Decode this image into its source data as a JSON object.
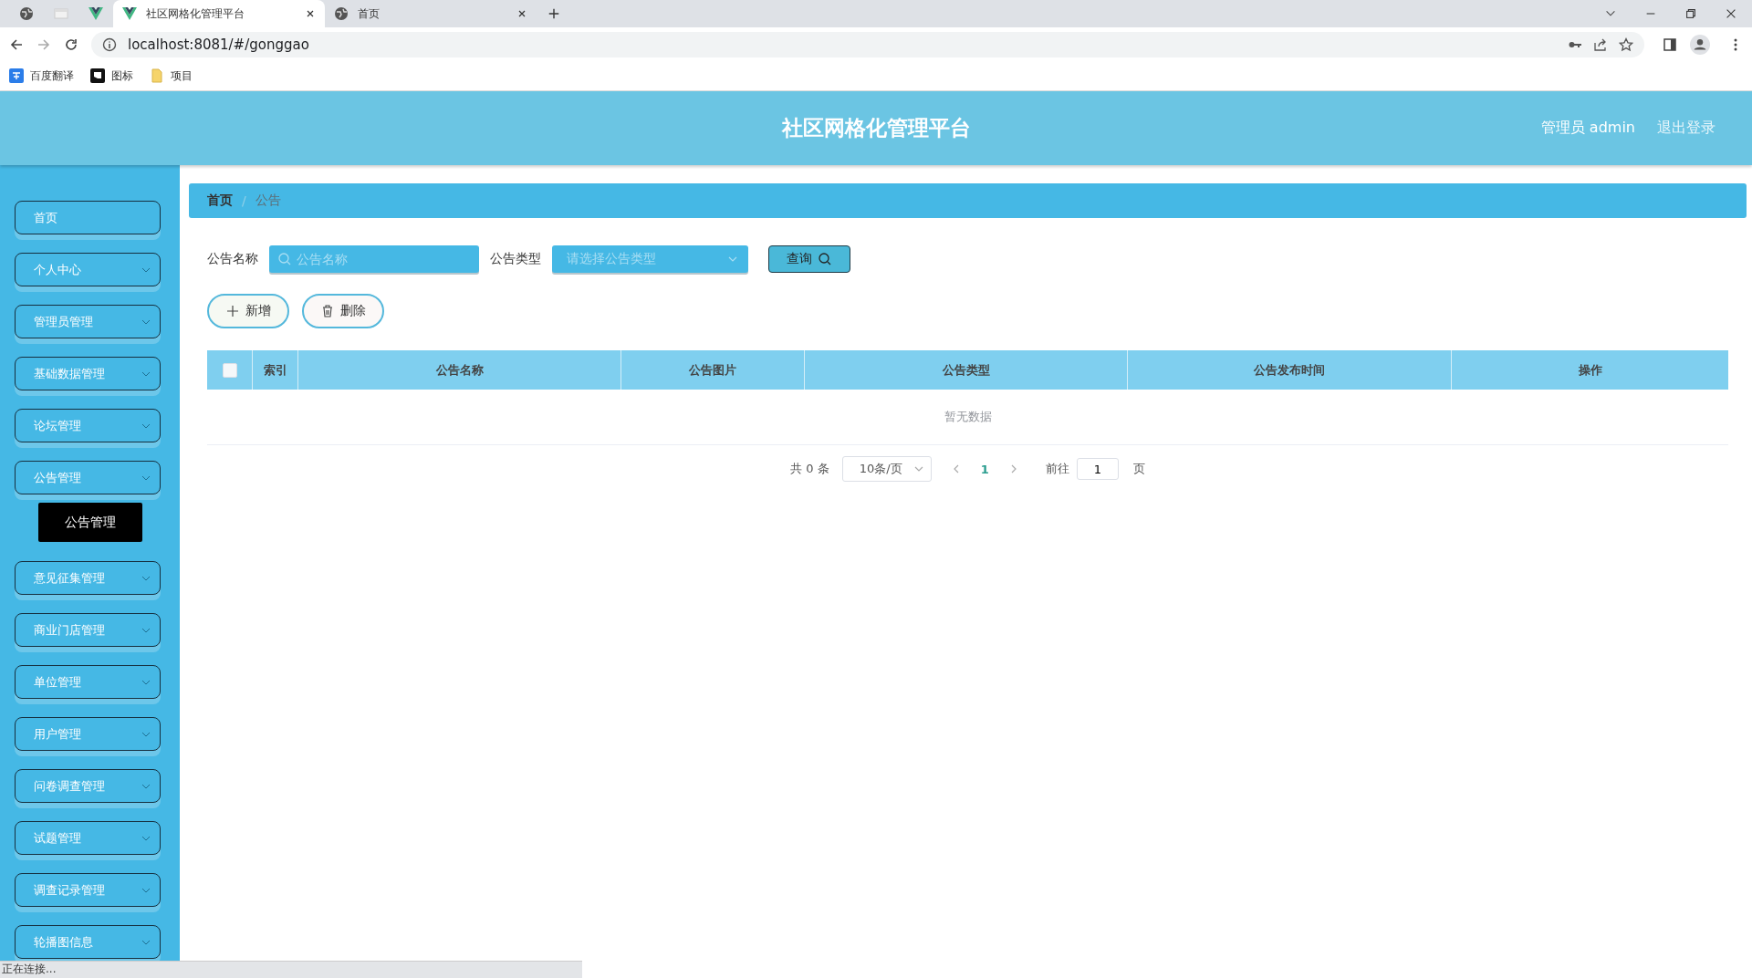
{
  "browser": {
    "tabs": [
      {
        "title": "社区网格化管理平台",
        "selected": true
      },
      {
        "title": "首页",
        "selected": false
      }
    ],
    "address": "localhost:8081/#/gonggao",
    "bookmarks": [
      {
        "label": "百度翻译",
        "kind": "translate"
      },
      {
        "label": "图标",
        "kind": "flag"
      },
      {
        "label": "项目",
        "kind": "folder"
      }
    ],
    "status": "正在连接..."
  },
  "header": {
    "title": "社区网格化管理平台",
    "user": "管理员 admin",
    "logout": "退出登录"
  },
  "sidebar": {
    "items": [
      {
        "label": "首页",
        "kind": "link"
      },
      {
        "label": "个人中心",
        "kind": "submenu"
      },
      {
        "label": "管理员管理",
        "kind": "submenu"
      },
      {
        "label": "基础数据管理",
        "kind": "submenu"
      },
      {
        "label": "论坛管理",
        "kind": "submenu"
      },
      {
        "label": "公告管理",
        "kind": "submenu",
        "children": [
          {
            "label": "公告管理"
          }
        ]
      },
      {
        "label": "意见征集管理",
        "kind": "submenu"
      },
      {
        "label": "商业门店管理",
        "kind": "submenu"
      },
      {
        "label": "单位管理",
        "kind": "submenu"
      },
      {
        "label": "用户管理",
        "kind": "submenu"
      },
      {
        "label": "问卷调查管理",
        "kind": "submenu"
      },
      {
        "label": "试题管理",
        "kind": "submenu"
      },
      {
        "label": "调查记录管理",
        "kind": "submenu"
      },
      {
        "label": "轮播图信息",
        "kind": "submenu"
      }
    ]
  },
  "breadcrumb": [
    "首页",
    "公告"
  ],
  "breadcrumb_separator": "/",
  "filters": {
    "name_label": "公告名称",
    "name_placeholder": "公告名称",
    "type_label": "公告类型",
    "type_placeholder": "请选择公告类型",
    "query": "查询"
  },
  "actions": [
    {
      "label": "新增",
      "kind": "add"
    },
    {
      "label": "删除",
      "kind": "delete"
    }
  ],
  "table": {
    "select_all": {
      "checked": false
    },
    "columns": [
      "索引",
      "公告名称",
      "公告图片",
      "公告类型",
      "公告发布时间",
      "操作"
    ],
    "empty": "暂无数据"
  },
  "pagination": {
    "total": "共 0 条",
    "page_size": "10条/页",
    "pages": [
      {
        "label": "1",
        "selected": true
      }
    ],
    "goto": "前往",
    "goto_value": "1",
    "goto_suffix": "页"
  }
}
